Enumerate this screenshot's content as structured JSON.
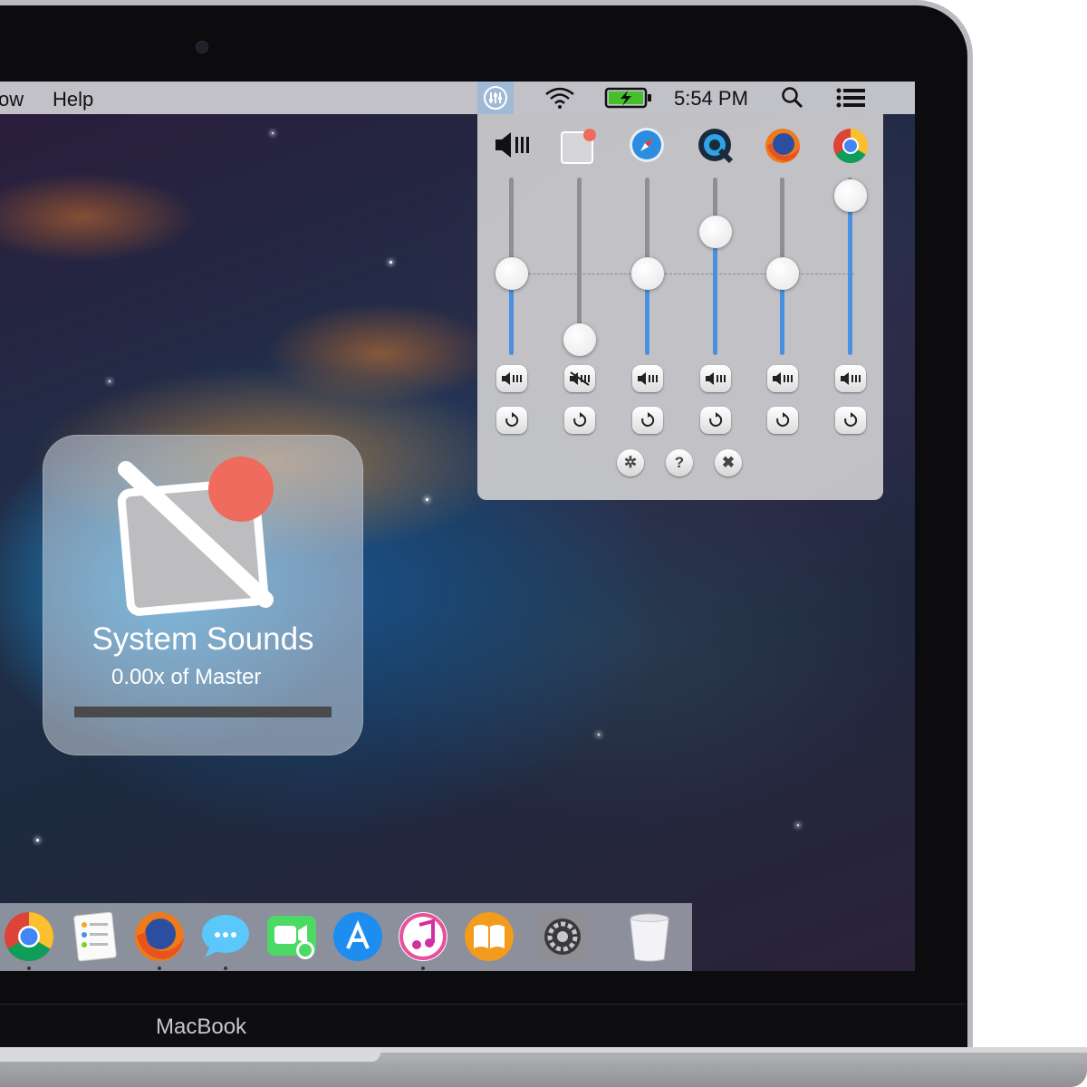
{
  "menubar": {
    "items": [
      {
        "label": "ow"
      },
      {
        "label": "Help"
      }
    ],
    "clock": "5:54 PM",
    "icons": [
      "mixer-icon",
      "wifi-icon",
      "battery-charging-icon",
      "spotlight-search-icon",
      "notification-center-icon"
    ]
  },
  "mixer": {
    "channels": [
      {
        "name": "master-volume-icon",
        "level": 0.5,
        "muted": false
      },
      {
        "name": "system-sounds-icon",
        "level": 0.0,
        "muted": true
      },
      {
        "name": "safari-icon",
        "level": 0.5,
        "muted": false
      },
      {
        "name": "quicktime-icon",
        "level": 0.7,
        "muted": false
      },
      {
        "name": "firefox-icon",
        "level": 0.5,
        "muted": false
      },
      {
        "name": "chrome-icon",
        "level": 0.9,
        "muted": false
      }
    ],
    "footer_icons": [
      "settings-icon",
      "help-icon",
      "close-icon"
    ],
    "help_glyph": "?",
    "close_glyph": "✖",
    "settings_glyph": "✲",
    "accent": "#4a90e2"
  },
  "hud": {
    "title": "System Sounds",
    "subtitle": "0.00x of Master",
    "level": 0.0
  },
  "dock": {
    "icons": [
      "chrome-icon",
      "reminders-icon",
      "firefox-icon",
      "messages-icon",
      "facetime-icon",
      "app-store-icon",
      "itunes-icon",
      "ibooks-icon",
      "system-preferences-icon",
      "trash-icon"
    ]
  },
  "laptop": {
    "brand": "MacBook"
  }
}
